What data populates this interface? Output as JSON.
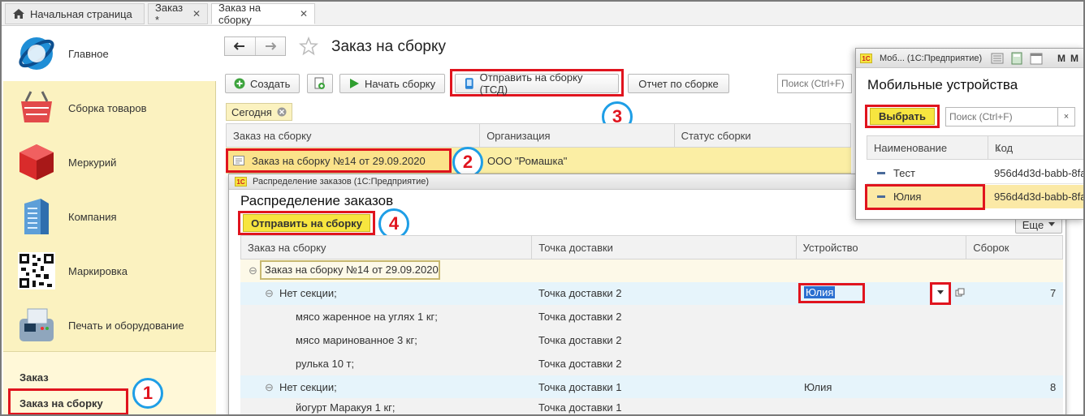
{
  "top_tabs": {
    "home": "Начальная страница",
    "order": "Заказ *",
    "assembly": "Заказ на сборку",
    "close": "✕"
  },
  "sidebar": {
    "items": [
      {
        "label": "Главное",
        "icon": "globe-icon"
      },
      {
        "label": "Сборка товаров",
        "icon": "basket-icon"
      },
      {
        "label": "Меркурий",
        "icon": "cube-icon"
      },
      {
        "label": "Компания",
        "icon": "building-icon"
      },
      {
        "label": "Маркировка",
        "icon": "qr-code-icon"
      },
      {
        "label": "Печать и оборудование",
        "icon": "terminal-icon"
      }
    ],
    "sub": {
      "order": "Заказ",
      "assembly": "Заказ на сборку"
    }
  },
  "main": {
    "title": "Заказ на сборку",
    "buttons": {
      "create": "Создать",
      "start": "Начать сборку",
      "send_tsd": "Отправить на сборку (ТСД)",
      "report": "Отчет по сборке"
    },
    "search_placeholder": "Поиск (Ctrl+F)",
    "filter_chip": "Сегодня",
    "columns": [
      "Заказ на сборку",
      "Организация",
      "Статус сборки"
    ],
    "row": {
      "order": "Заказ на сборку №14 от 29.09.2020",
      "org": "ООО \"Ромашка\"",
      "status": ""
    }
  },
  "distribution": {
    "window_title": "Распределение заказов (1С:Предприятие)",
    "title": "Распределение заказов",
    "send_button": "Отправить на сборку",
    "more": "Еще",
    "columns": [
      "Заказ на сборку",
      "Точка доставки",
      "Устройство",
      "Сборок"
    ],
    "group": "Заказ на сборку №14 от 29.09.2020",
    "rows": [
      {
        "name": "Нет секции;",
        "point": "Точка  доставки 2",
        "device": "Юлия",
        "count": "7",
        "level": 1
      },
      {
        "name": "мясо жаренное на углях 1 кг;",
        "point": "Точка  доставки 2",
        "device": "",
        "count": "",
        "level": 2
      },
      {
        "name": "мясо маринованное 3 кг;",
        "point": "Точка  доставки 2",
        "device": "",
        "count": "",
        "level": 2
      },
      {
        "name": "рулька 10 т;",
        "point": "Точка  доставки 2",
        "device": "",
        "count": "",
        "level": 2
      },
      {
        "name": "Нет секции;",
        "point": "Точка  доставки 1",
        "device": "Юлия",
        "count": "8",
        "level": 1
      },
      {
        "name": "йогурт Маракуя 1 кг;",
        "point": "Точка  доставки 1",
        "device": "",
        "count": "",
        "level": 2
      }
    ]
  },
  "mobile": {
    "window_title": "Моб...  (1С:Предприятие)",
    "title": "Мобильные устройства",
    "select_button": "Выбрать",
    "search_placeholder": "Поиск (Ctrl+F)",
    "columns": [
      "Наименование",
      "Код"
    ],
    "rows": [
      {
        "name": "Тест",
        "code": "956d4d3d-babb-8fa"
      },
      {
        "name": "Юлия",
        "code": "956d4d3d-babb-8fa"
      }
    ]
  },
  "badges": [
    "1",
    "2",
    "3",
    "4"
  ],
  "colors": {
    "accent_red": "#e0141e",
    "badge_blue": "#1e9ee6",
    "yellow": "#f7e53f",
    "sidebar": "#fbf2c0"
  }
}
